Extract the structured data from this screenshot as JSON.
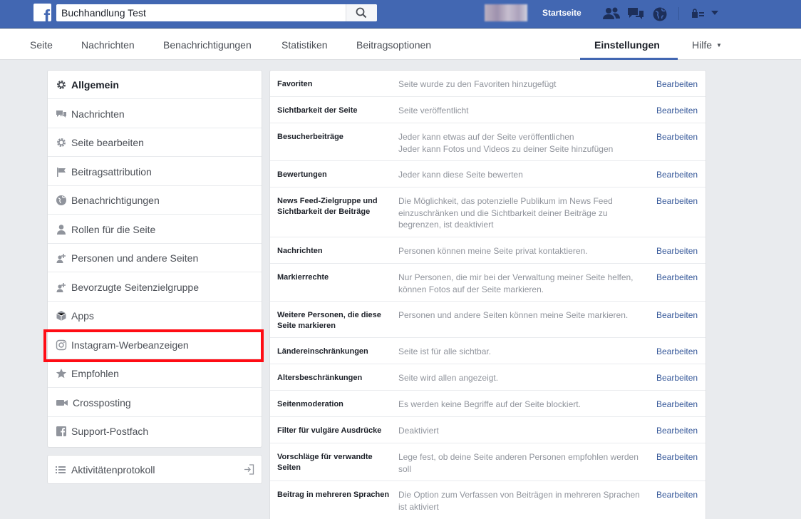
{
  "topbar": {
    "search_value": "Buchhandlung Test",
    "home_label": "Startseite",
    "icons": [
      "facebook-logo-icon",
      "search-icon",
      "friends-icon",
      "messages-icon",
      "globe-icon",
      "lock-icon",
      "chevron-down-icon"
    ],
    "brand_color": "#4267b2"
  },
  "subnav": {
    "items": [
      "Seite",
      "Nachrichten",
      "Benachrichtigungen",
      "Statistiken",
      "Beitragsoptionen"
    ],
    "active": "Einstellungen",
    "help": "Hilfe"
  },
  "sidebar": {
    "items": [
      {
        "label": "Allgemein",
        "icon": "gear-icon"
      },
      {
        "label": "Nachrichten",
        "icon": "messages-icon"
      },
      {
        "label": "Seite bearbeiten",
        "icon": "gear-icon"
      },
      {
        "label": "Beitragsattribution",
        "icon": "flag-icon"
      },
      {
        "label": "Benachrichtigungen",
        "icon": "globe-icon"
      },
      {
        "label": "Rollen für die Seite",
        "icon": "person-icon"
      },
      {
        "label": "Personen und andere Seiten",
        "icon": "person-add-icon"
      },
      {
        "label": "Bevorzugte Seitenzielgruppe",
        "icon": "person-add-icon"
      },
      {
        "label": "Apps",
        "icon": "cube-icon"
      },
      {
        "label": "Instagram-Werbeanzeigen",
        "icon": "instagram-icon"
      },
      {
        "label": "Empfohlen",
        "icon": "star-icon"
      },
      {
        "label": "Crossposting",
        "icon": "video-camera-icon"
      },
      {
        "label": "Support-Postfach",
        "icon": "facebook-square-icon"
      }
    ],
    "activity_log": "Aktivitätenprotokoll",
    "highlight_color": "#ff0c14"
  },
  "settings": {
    "edit_label": "Bearbeiten",
    "rows": [
      {
        "name": "Favoriten",
        "desc": [
          "Seite wurde zu den Favoriten hinzugefügt"
        ]
      },
      {
        "name": "Sichtbarkeit der Seite",
        "desc": [
          "Seite veröffentlicht"
        ]
      },
      {
        "name": "Besucherbeiträge",
        "desc": [
          "Jeder kann etwas auf der Seite veröffentlichen",
          "Jeder kann Fotos und Videos zu deiner Seite hinzufügen"
        ]
      },
      {
        "name": "Bewertungen",
        "desc": [
          "Jeder kann diese Seite bewerten"
        ]
      },
      {
        "name": "News Feed-Zielgruppe und Sichtbarkeit der Beiträge",
        "desc": [
          "Die Möglichkeit, das potenzielle Publikum im News Feed einzuschränken und die Sichtbarkeit deiner Beiträge zu begrenzen, ist deaktiviert"
        ]
      },
      {
        "name": "Nachrichten",
        "desc": [
          "Personen können meine Seite privat kontaktieren."
        ]
      },
      {
        "name": "Markierrechte",
        "desc": [
          "Nur Personen, die mir bei der Verwaltung meiner Seite helfen, können Fotos auf der Seite markieren."
        ]
      },
      {
        "name": "Weitere Personen, die diese Seite markieren",
        "desc": [
          "Personen und andere Seiten können meine Seite markieren."
        ]
      },
      {
        "name": "Ländereinschränkungen",
        "desc": [
          "Seite ist für alle sichtbar."
        ]
      },
      {
        "name": "Altersbeschränkungen",
        "desc": [
          "Seite wird allen angezeigt."
        ]
      },
      {
        "name": "Seitenmoderation",
        "desc": [
          "Es werden keine Begriffe auf der Seite blockiert."
        ]
      },
      {
        "name": "Filter für vulgäre Ausdrücke",
        "desc": [
          "Deaktiviert"
        ]
      },
      {
        "name": "Vorschläge für verwandte Seiten",
        "desc": [
          "Lege fest, ob deine Seite anderen Personen empfohlen werden soll"
        ]
      },
      {
        "name": "Beitrag in mehreren Sprachen",
        "desc": [
          "Die Option zum Verfassen von Beiträgen in mehreren Sprachen ist aktiviert"
        ]
      }
    ]
  }
}
